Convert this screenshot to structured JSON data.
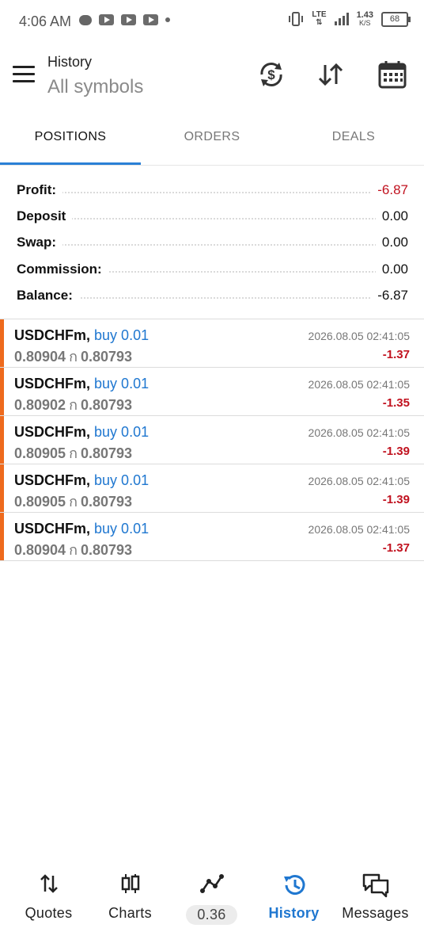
{
  "status": {
    "time": "4:06 AM",
    "network": "LTE",
    "speed": "1.43",
    "speed_unit": "K/S",
    "battery": "68"
  },
  "header": {
    "title": "History",
    "subtitle": "All symbols"
  },
  "tabs": [
    {
      "label": "POSITIONS",
      "active": true
    },
    {
      "label": "ORDERS",
      "active": false
    },
    {
      "label": "DEALS",
      "active": false
    }
  ],
  "summary": [
    {
      "label": "Profit:",
      "value": "-6.87",
      "negative": true
    },
    {
      "label": "Deposit",
      "value": "0.00",
      "negative": false
    },
    {
      "label": "Swap:",
      "value": "0.00",
      "negative": false
    },
    {
      "label": "Commission:",
      "value": "0.00",
      "negative": false
    },
    {
      "label": "Balance:",
      "value": "-6.87",
      "negative": false
    }
  ],
  "deals": [
    {
      "symbol": "USDCHFm,",
      "type": "buy 0.01",
      "open": "0.80904",
      "arrow": "ก",
      "close": "0.80793",
      "time": "2026.08.05 02:41:05",
      "profit": "-1.37"
    },
    {
      "symbol": "USDCHFm,",
      "type": "buy 0.01",
      "open": "0.80902",
      "arrow": "ก",
      "close": "0.80793",
      "time": "2026.08.05 02:41:05",
      "profit": "-1.35"
    },
    {
      "symbol": "USDCHFm,",
      "type": "buy 0.01",
      "open": "0.80905",
      "arrow": "ก",
      "close": "0.80793",
      "time": "2026.08.05 02:41:05",
      "profit": "-1.39"
    },
    {
      "symbol": "USDCHFm,",
      "type": "buy 0.01",
      "open": "0.80905",
      "arrow": "ก",
      "close": "0.80793",
      "time": "2026.08.05 02:41:05",
      "profit": "-1.39"
    },
    {
      "symbol": "USDCHFm,",
      "type": "buy 0.01",
      "open": "0.80904",
      "arrow": "ก",
      "close": "0.80793",
      "time": "2026.08.05 02:41:05",
      "profit": "-1.37"
    }
  ],
  "nav": [
    {
      "label": "Quotes",
      "icon": "quotes-icon"
    },
    {
      "label": "Charts",
      "icon": "charts-icon"
    },
    {
      "label": "0.36",
      "icon": "trade-icon"
    },
    {
      "label": "History",
      "icon": "history-icon",
      "active": true
    },
    {
      "label": "Messages",
      "icon": "messages-icon"
    }
  ],
  "colors": {
    "accent": "#1f77d0",
    "negative": "#c1121f",
    "buy_bar": "#ee6a1d"
  }
}
